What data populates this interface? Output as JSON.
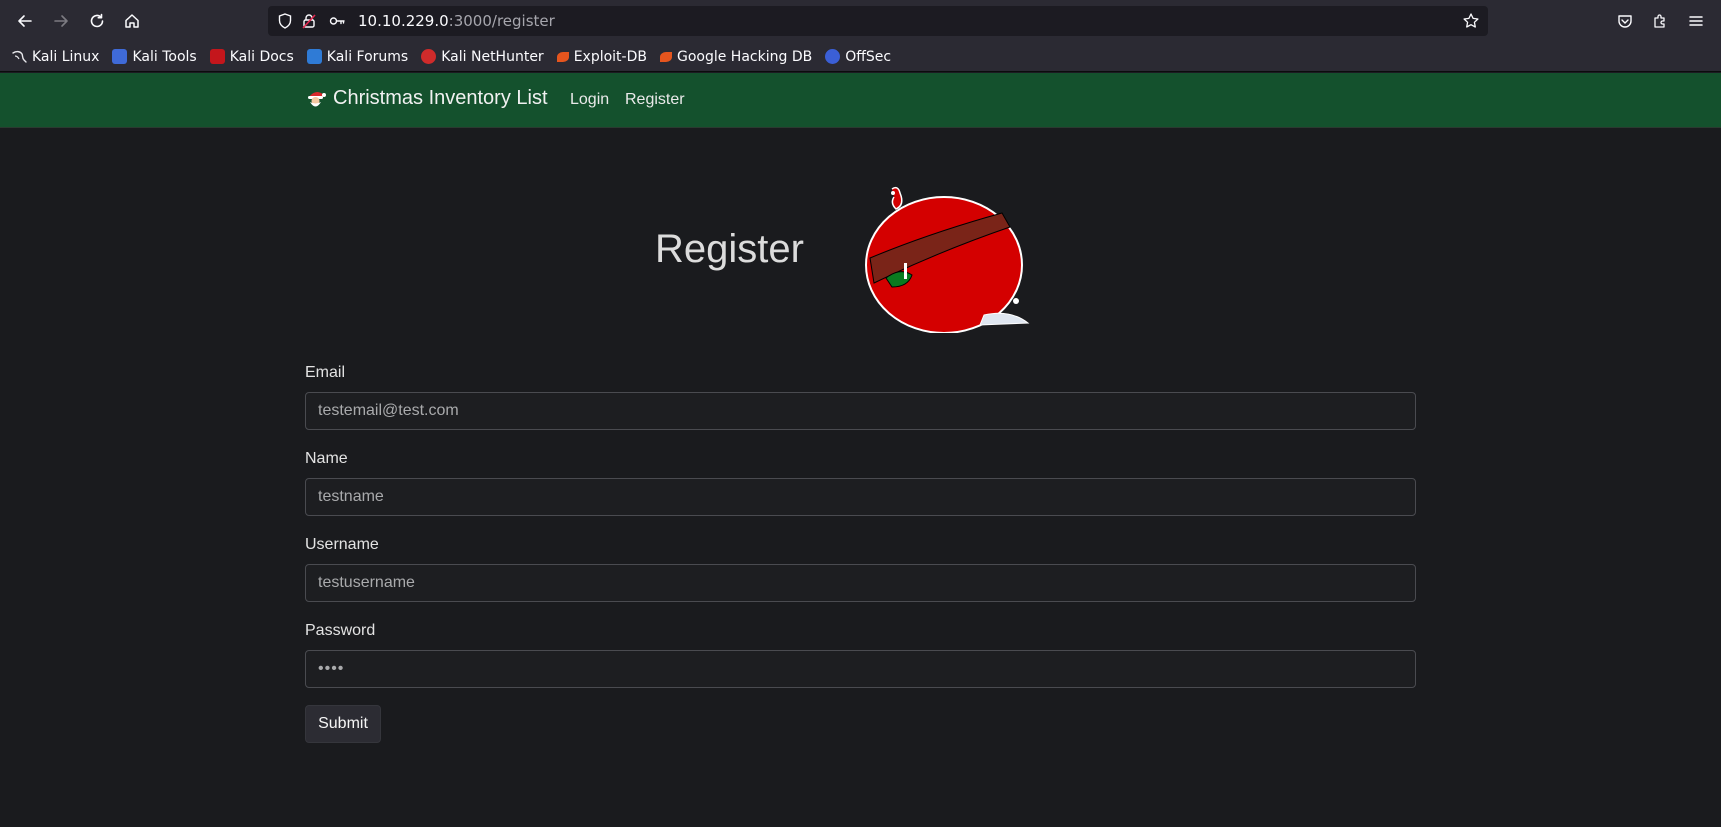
{
  "browser": {
    "url_host": "10.10.229.0",
    "url_path": ":3000/register",
    "bookmarks": [
      {
        "label": "Kali Linux",
        "icon": "kali-dragon-icon",
        "color": "#2b2a33"
      },
      {
        "label": "Kali Tools",
        "icon": "kali-tools-icon",
        "color": "#3f6ad8"
      },
      {
        "label": "Kali Docs",
        "icon": "kali-docs-icon",
        "color": "#c4161c"
      },
      {
        "label": "Kali Forums",
        "icon": "kali-forums-icon",
        "color": "#2f7bd6"
      },
      {
        "label": "Kali NetHunter",
        "icon": "kali-nethunter-icon",
        "color": "#d02b2b"
      },
      {
        "label": "Exploit-DB",
        "icon": "exploit-db-icon",
        "color": "#e5551e"
      },
      {
        "label": "Google Hacking DB",
        "icon": "ghdb-icon",
        "color": "#e5551e"
      },
      {
        "label": "OffSec",
        "icon": "offsec-icon",
        "color": "#3b5fd6"
      }
    ]
  },
  "navbar": {
    "brand": "Christmas Inventory List",
    "links": [
      "Login",
      "Register"
    ],
    "background": "#14512d"
  },
  "main": {
    "title": "Register",
    "form": {
      "email_label": "Email",
      "email_value": "testemail@test.com",
      "name_label": "Name",
      "name_value": "testname",
      "username_label": "Username",
      "username_value": "testusername",
      "password_label": "Password",
      "password_value": "••••",
      "submit_label": "Submit"
    }
  }
}
